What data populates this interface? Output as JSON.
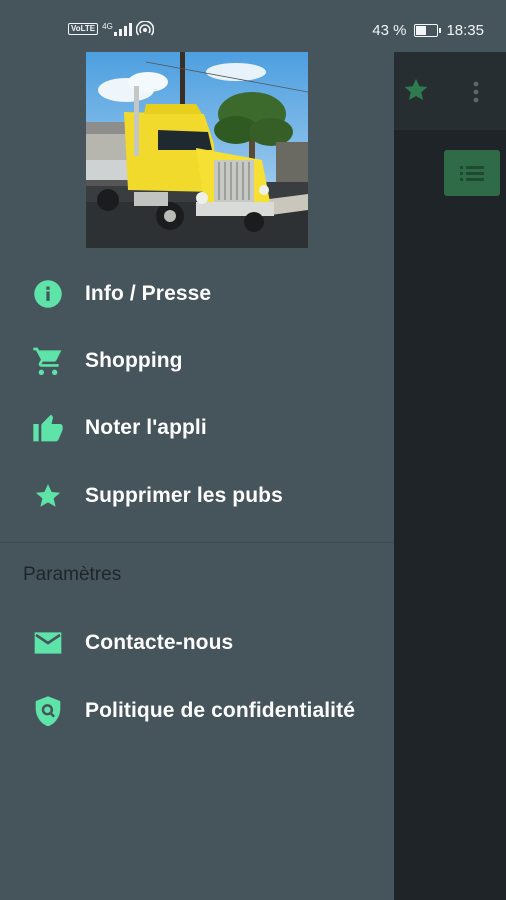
{
  "status_bar": {
    "network": "4G",
    "battery": "43 %",
    "battery_level": 0.43,
    "time": "18:35"
  },
  "colors": {
    "drawer_bg": "#46545c",
    "accent": "#5ee3a8",
    "app_bg": "#1e2427",
    "app_button": "#2f6b47"
  },
  "drawer": {
    "header_image": "yellow-semi-truck-photo",
    "menu": [
      {
        "label": "Info / Presse",
        "icon": "info-icon"
      },
      {
        "label": "Shopping",
        "icon": "cart-icon"
      },
      {
        "label": "Noter l'appli",
        "icon": "thumb-up-icon"
      },
      {
        "label": "Supprimer les pubs",
        "icon": "star-icon"
      }
    ],
    "section_title": "Paramètres",
    "settings": [
      {
        "label": "Contacte-nous",
        "icon": "mail-icon"
      },
      {
        "label": "Politique de confidentialité",
        "icon": "shield-icon"
      }
    ]
  },
  "app_toolbar": {
    "icons": [
      "star-icon",
      "more-vert-icon",
      "list-icon"
    ]
  }
}
